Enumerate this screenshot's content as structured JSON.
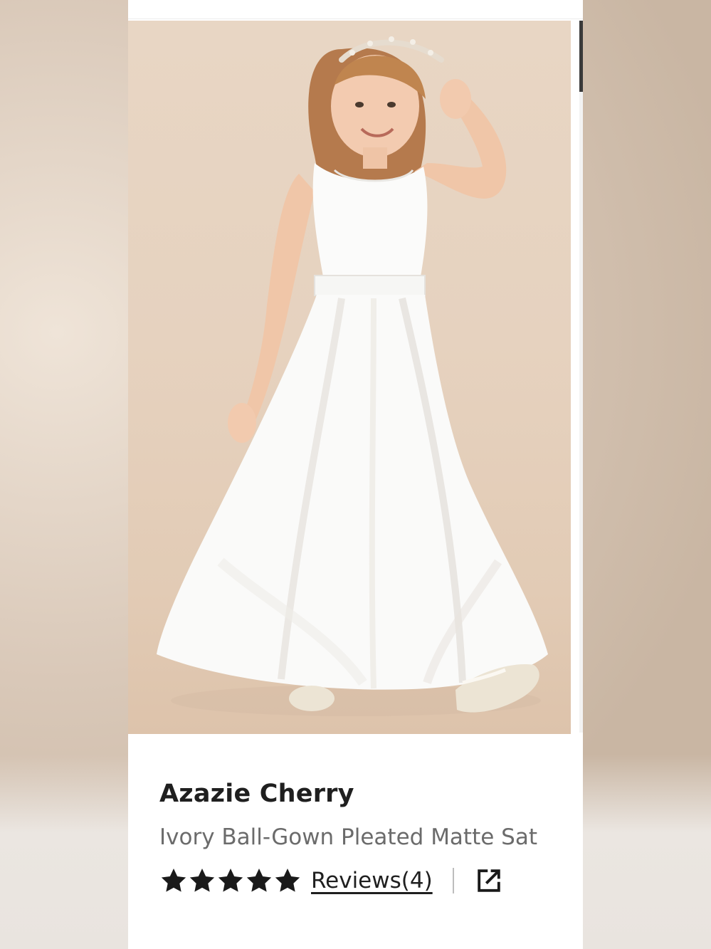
{
  "product": {
    "brand": "Azazie Cherry",
    "name": "Ivory Ball-Gown Pleated Matte Sat",
    "rating_stars": 5,
    "reviews_label": "Reviews(4)"
  },
  "icons": {
    "star": "star-icon",
    "share": "external-link-icon"
  },
  "colors": {
    "text_primary": "#1f1f1f",
    "text_secondary": "#6b6b6b",
    "background_image": "#e6d2bf"
  }
}
